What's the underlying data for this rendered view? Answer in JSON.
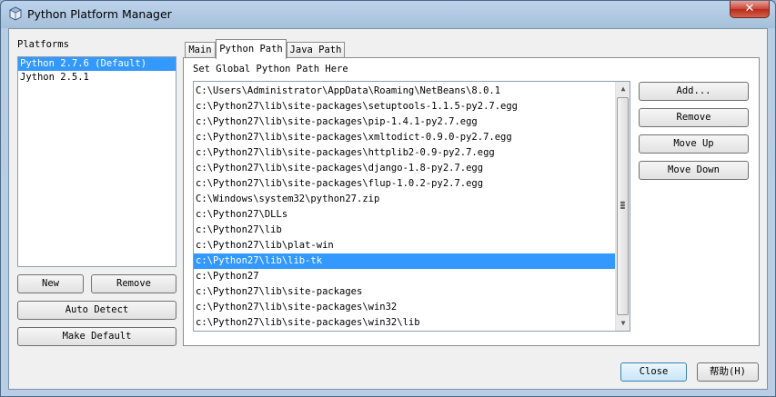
{
  "window": {
    "title": "Python Platform Manager",
    "close_glyph": "✕",
    "icon": "app-icon"
  },
  "platforms": {
    "label": "Platforms",
    "items": [
      "Python 2.7.6 (Default)",
      "Jython 2.5.1"
    ],
    "selected_index": 0
  },
  "left_buttons": {
    "new": "New",
    "remove": "Remove",
    "auto_detect": "Auto Detect",
    "make_default": "Make Default"
  },
  "tabs": [
    "Main",
    "Python Path",
    "Java Path"
  ],
  "active_tab": 1,
  "python_path": {
    "heading": "Set Global Python Path Here",
    "items": [
      "C:\\Users\\Administrator\\AppData\\Roaming\\NetBeans\\8.0.1",
      "c:\\Python27\\lib\\site-packages\\setuptools-1.1.5-py2.7.egg",
      "c:\\Python27\\lib\\site-packages\\pip-1.4.1-py2.7.egg",
      "c:\\Python27\\lib\\site-packages\\xmltodict-0.9.0-py2.7.egg",
      "c:\\Python27\\lib\\site-packages\\httplib2-0.9-py2.7.egg",
      "c:\\Python27\\lib\\site-packages\\django-1.8-py2.7.egg",
      "c:\\Python27\\lib\\site-packages\\flup-1.0.2-py2.7.egg",
      "C:\\Windows\\system32\\python27.zip",
      "c:\\Python27\\DLLs",
      "c:\\Python27\\lib",
      "c:\\Python27\\lib\\plat-win",
      "c:\\Python27\\lib\\lib-tk",
      "c:\\Python27",
      "c:\\Python27\\lib\\site-packages",
      "c:\\Python27\\lib\\site-packages\\win32",
      "c:\\Python27\\lib\\site-packages\\win32\\lib"
    ],
    "selected_index": 11
  },
  "path_buttons": {
    "add": "Add...",
    "remove": "Remove",
    "move_up": "Move Up",
    "move_down": "Move Down"
  },
  "bottom_buttons": {
    "close": "Close",
    "help": "帮助(H)"
  },
  "scrollbar": {
    "up_glyph": "▲",
    "down_glyph": "▼",
    "grip_glyph": "≡"
  }
}
